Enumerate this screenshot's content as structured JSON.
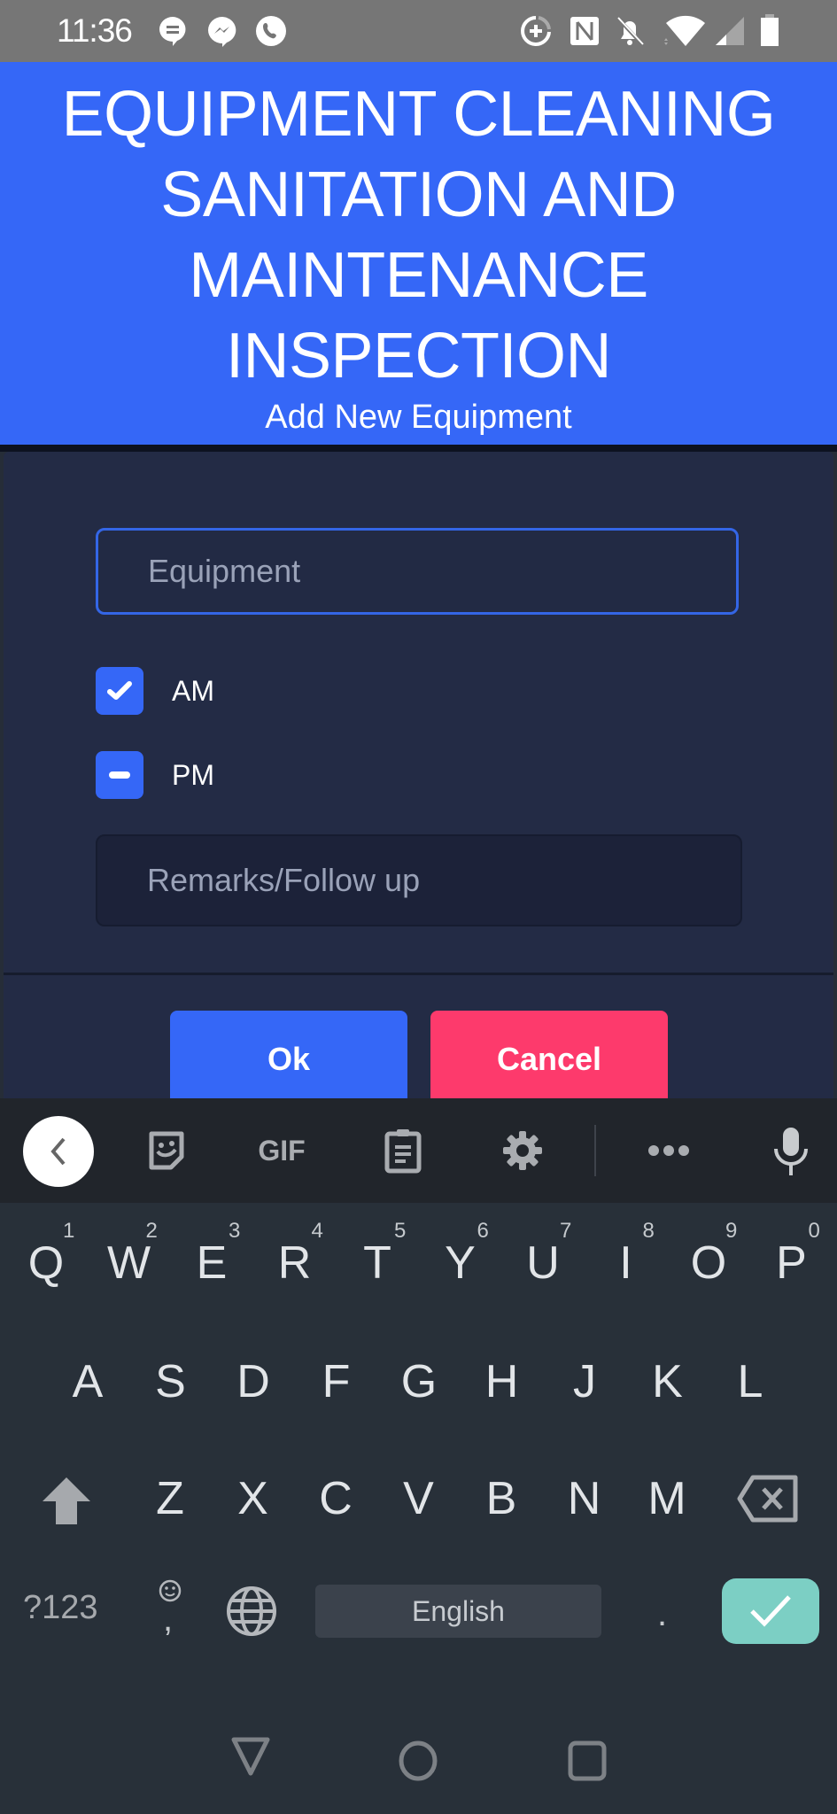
{
  "status_bar": {
    "time": "11:36",
    "left_icons": [
      "google-messages-icon",
      "messenger-icon",
      "phone-call-icon"
    ],
    "right_icons": [
      "data-saver-icon",
      "nfc-icon",
      "notifications-off-icon",
      "wifi-icon",
      "cell-signal-icon",
      "battery-icon"
    ]
  },
  "header": {
    "title": "EQUIPMENT CLEANING SANITATION AND MAINTENANCE INSPECTION",
    "subtitle": "Add New Equipment",
    "background_color": "#3567f7"
  },
  "dialog": {
    "equipment_input": {
      "placeholder": "Equipment",
      "value": ""
    },
    "checkboxes": [
      {
        "label": "AM",
        "state": "checked"
      },
      {
        "label": "PM",
        "state": "indeterminate"
      }
    ],
    "remarks_input": {
      "placeholder": "Remarks/Follow up",
      "value": ""
    },
    "ok_label": "Ok",
    "cancel_label": "Cancel",
    "ok_color": "#3567f7",
    "cancel_color": "#fd3a6c"
  },
  "keyboard": {
    "toolbar": [
      "back-icon",
      "sticker-icon",
      "GIF",
      "clipboard-icon",
      "settings-icon",
      "more-icon",
      "microphone-icon"
    ],
    "gif_label": "GIF",
    "row1": [
      {
        "key": "Q",
        "hint": "1"
      },
      {
        "key": "W",
        "hint": "2"
      },
      {
        "key": "E",
        "hint": "3"
      },
      {
        "key": "R",
        "hint": "4"
      },
      {
        "key": "T",
        "hint": "5"
      },
      {
        "key": "Y",
        "hint": "6"
      },
      {
        "key": "U",
        "hint": "7"
      },
      {
        "key": "I",
        "hint": "8"
      },
      {
        "key": "O",
        "hint": "9"
      },
      {
        "key": "P",
        "hint": "0"
      }
    ],
    "row2": [
      "A",
      "S",
      "D",
      "F",
      "G",
      "H",
      "J",
      "K",
      "L"
    ],
    "row3": [
      "Z",
      "X",
      "C",
      "V",
      "B",
      "N",
      "M"
    ],
    "symbols_label": "?123",
    "comma_label": ",",
    "space_label": "English",
    "period_label": ".",
    "enter_color": "#7ccfc4"
  },
  "nav_bar": {
    "buttons": [
      "back-triangle-icon",
      "home-circle-icon",
      "recents-square-icon"
    ]
  }
}
